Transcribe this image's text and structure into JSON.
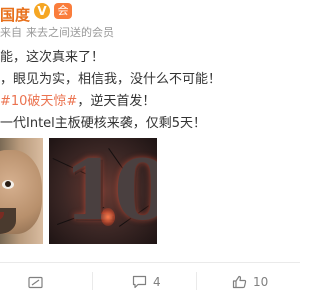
{
  "post": {
    "author_fragment": "国度",
    "badges": {
      "verified": "V",
      "vip": "会"
    },
    "meta": {
      "from_label": "来自",
      "separator": "",
      "source": "来去之间送的会员"
    },
    "lines": [
      "能，这次真来了！",
      "，眼见为实，相信我，没什么不可能！",
      {
        "hashtag": "#10破天惊#",
        "rest": "，逆天首发！"
      },
      "一代Intel主板硬核来袭，仅剩5天！"
    ],
    "images": [
      {
        "name": "man-face-photo"
      },
      {
        "name": "number-10-cracked-poster",
        "overlay_text": "10"
      }
    ],
    "actions": {
      "repost": {
        "icon": "repost-icon",
        "count": ""
      },
      "comment": {
        "icon": "comment-icon",
        "count": "4"
      },
      "like": {
        "icon": "like-icon",
        "count": "10"
      }
    }
  },
  "colors": {
    "name": "#e8711c",
    "hashtag": "#eb7350",
    "meta": "#999999",
    "text": "#333333"
  }
}
